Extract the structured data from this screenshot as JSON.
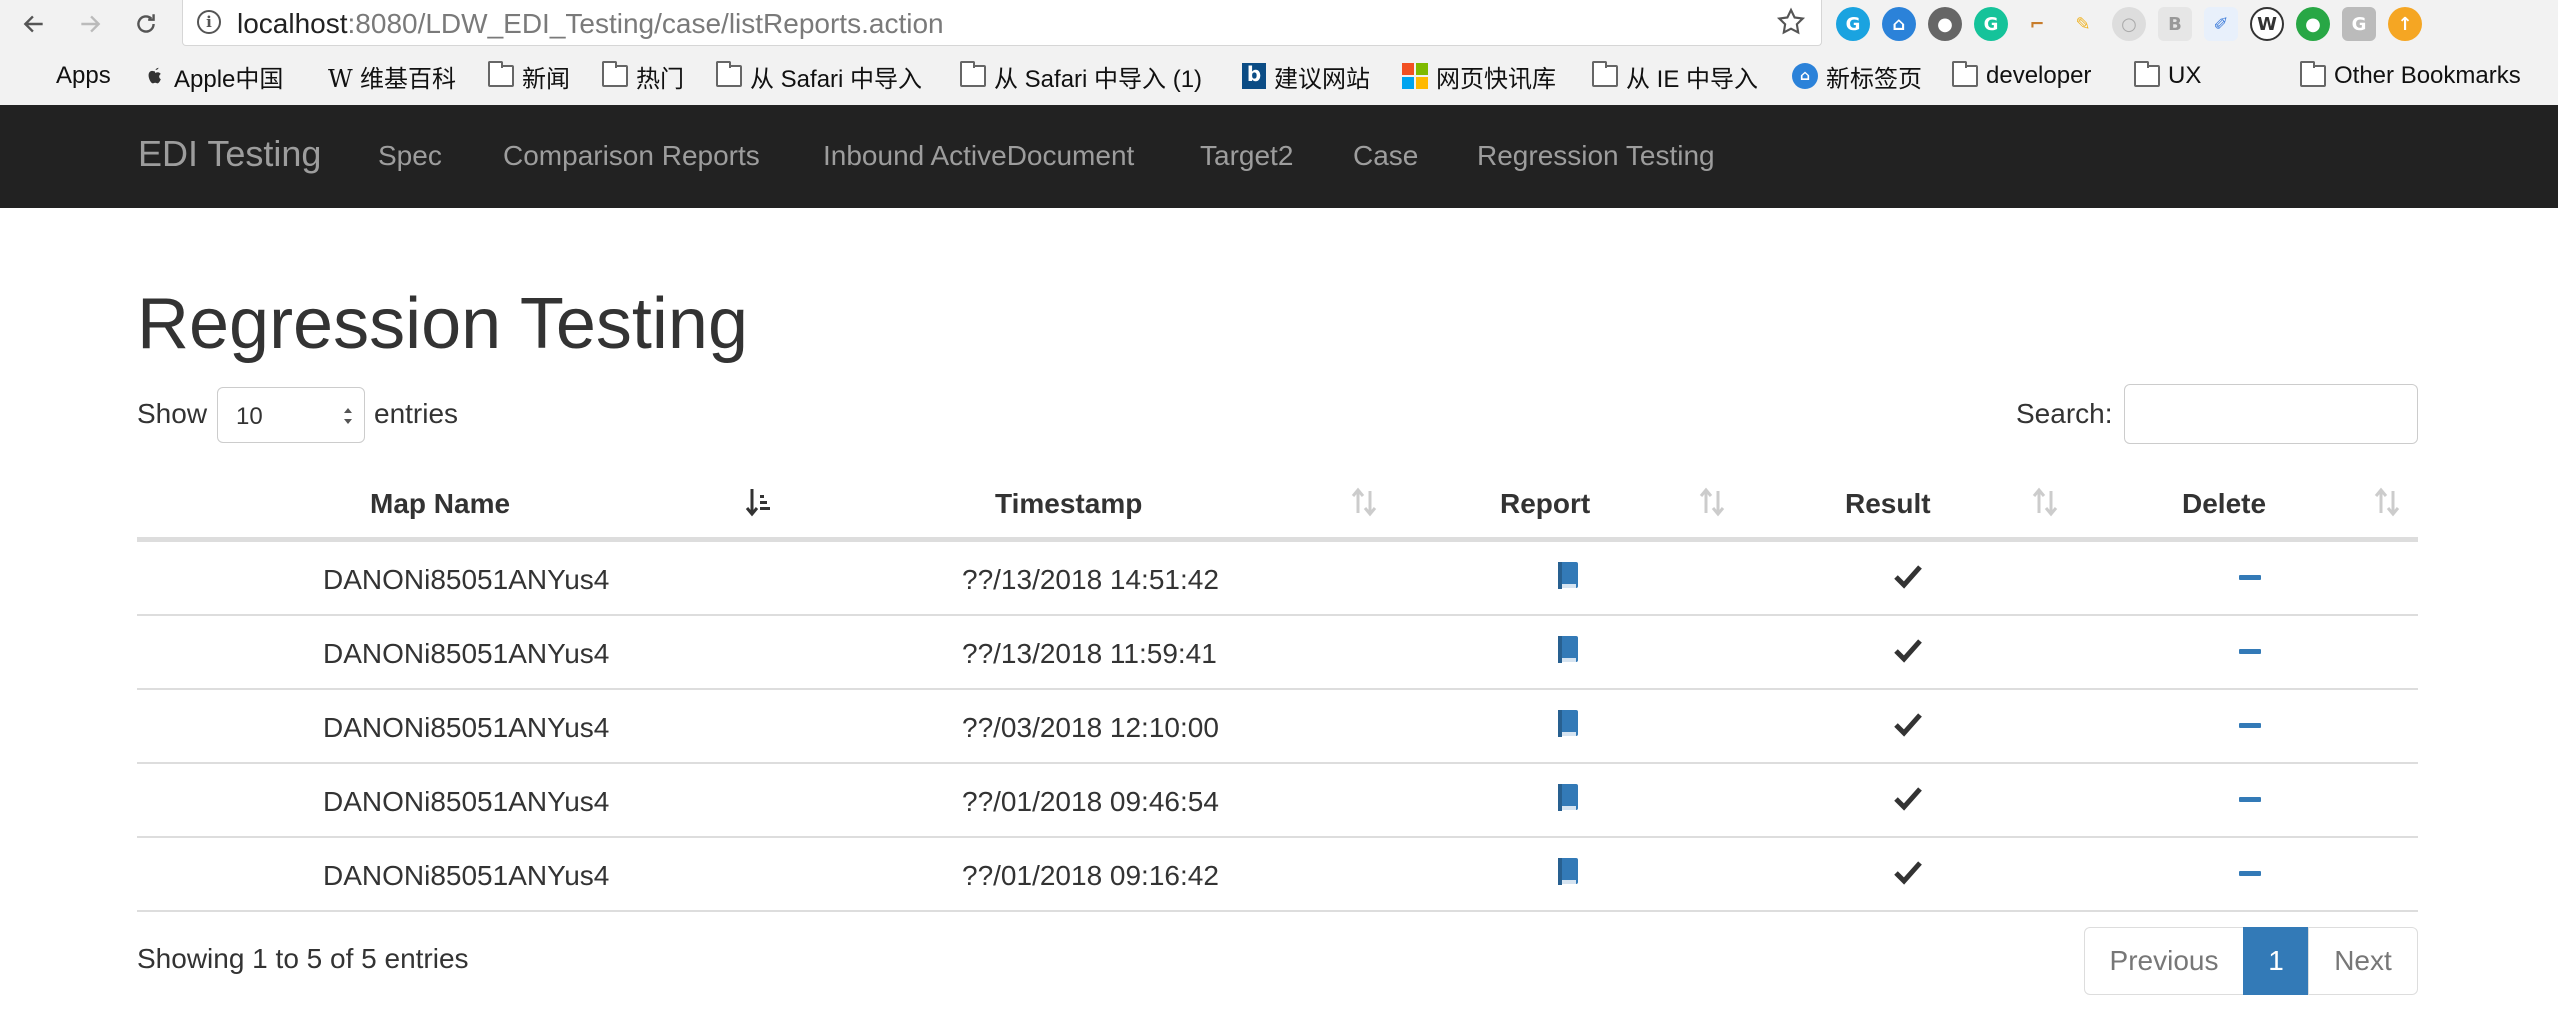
{
  "browser": {
    "url_host": "localhost",
    "url_path": ":8080/LDW_EDI_Testing/case/listReports.action",
    "bookmarks": [
      {
        "label": "Apps",
        "icon": "apps-grid-icon"
      },
      {
        "label": "Apple中国",
        "icon": "apple-icon"
      },
      {
        "label": "维基百科",
        "icon": "wikipedia-icon"
      },
      {
        "label": "新闻",
        "icon": "folder-icon"
      },
      {
        "label": "热门",
        "icon": "folder-icon"
      },
      {
        "label": "从 Safari 中导入",
        "icon": "folder-icon"
      },
      {
        "label": "从 Safari 中导入 (1)",
        "icon": "folder-icon"
      },
      {
        "label": "建议网站",
        "icon": "bing-icon"
      },
      {
        "label": "网页快讯库",
        "icon": "windows-icon"
      },
      {
        "label": "从 IE 中导入",
        "icon": "folder-icon"
      },
      {
        "label": "新标签页",
        "icon": "baidu-icon"
      },
      {
        "label": "developer",
        "icon": "folder-icon"
      },
      {
        "label": "UX",
        "icon": "folder-icon"
      },
      {
        "label": "Other Bookmarks",
        "icon": "folder-icon"
      }
    ],
    "overflow_chevron": "»"
  },
  "navbar": {
    "brand": "EDI Testing",
    "links": [
      "Spec",
      "Comparison Reports",
      "Inbound ActiveDocument",
      "Target2",
      "Case",
      "Regression Testing"
    ]
  },
  "page": {
    "title": "Regression Testing",
    "show_label": "Show",
    "page_size": "10",
    "entries_label": "entries",
    "search_label": "Search:",
    "search_value": ""
  },
  "table": {
    "columns": [
      "Map Name",
      "Timestamp",
      "Report",
      "Result",
      "Delete"
    ],
    "rows": [
      {
        "map_name": "DANONi85051ANYus4",
        "timestamp": "??/13/2018 14:51:42",
        "report": "book-icon",
        "result": "check-icon",
        "delete": "minus-icon"
      },
      {
        "map_name": "DANONi85051ANYus4",
        "timestamp": "??/13/2018 11:59:41",
        "report": "book-icon",
        "result": "check-icon",
        "delete": "minus-icon"
      },
      {
        "map_name": "DANONi85051ANYus4",
        "timestamp": "??/03/2018 12:10:00",
        "report": "book-icon",
        "result": "check-icon",
        "delete": "minus-icon"
      },
      {
        "map_name": "DANONi85051ANYus4",
        "timestamp": "??/01/2018 09:46:54",
        "report": "book-icon",
        "result": "check-icon",
        "delete": "minus-icon"
      },
      {
        "map_name": "DANONi85051ANYus4",
        "timestamp": "??/01/2018 09:16:42",
        "report": "book-icon",
        "result": "check-icon",
        "delete": "minus-icon"
      }
    ]
  },
  "footer": {
    "info": "Showing 1 to 5 of 5 entries",
    "previous": "Previous",
    "current_page": "1",
    "next": "Next"
  },
  "colors": {
    "navbar_bg": "#222222",
    "accent": "#337ab7",
    "link_muted": "#9d9d9d"
  }
}
